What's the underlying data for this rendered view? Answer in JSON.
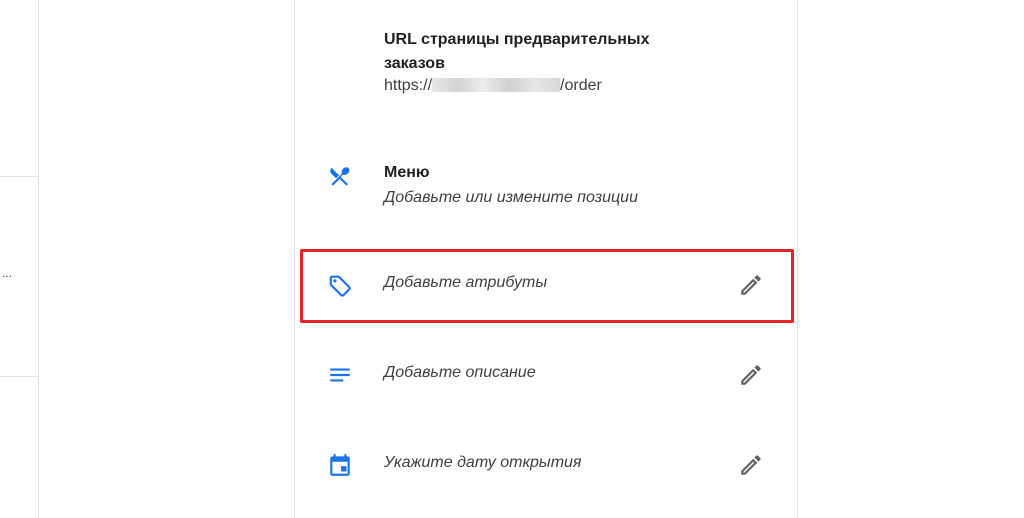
{
  "preorder": {
    "title": "URL страницы предварительных заказов",
    "url_prefix": "https://",
    "url_suffix": "/order"
  },
  "menu": {
    "title": "Меню",
    "subtitle": "Добавьте или измените позиции",
    "icon": "fork-spoon-icon"
  },
  "attributes": {
    "label": "Добавьте атрибуты",
    "icon": "tag-icon"
  },
  "description": {
    "label": "Добавьте описание",
    "icon": "text-lines-icon"
  },
  "opening_date": {
    "label": "Укажите дату открытия",
    "icon": "calendar-icon"
  },
  "sidebar": {
    "truncated_text": "..."
  },
  "colors": {
    "accent": "#1a73e8",
    "highlight": "#e5232a",
    "edit_icon": "#5f6368"
  }
}
